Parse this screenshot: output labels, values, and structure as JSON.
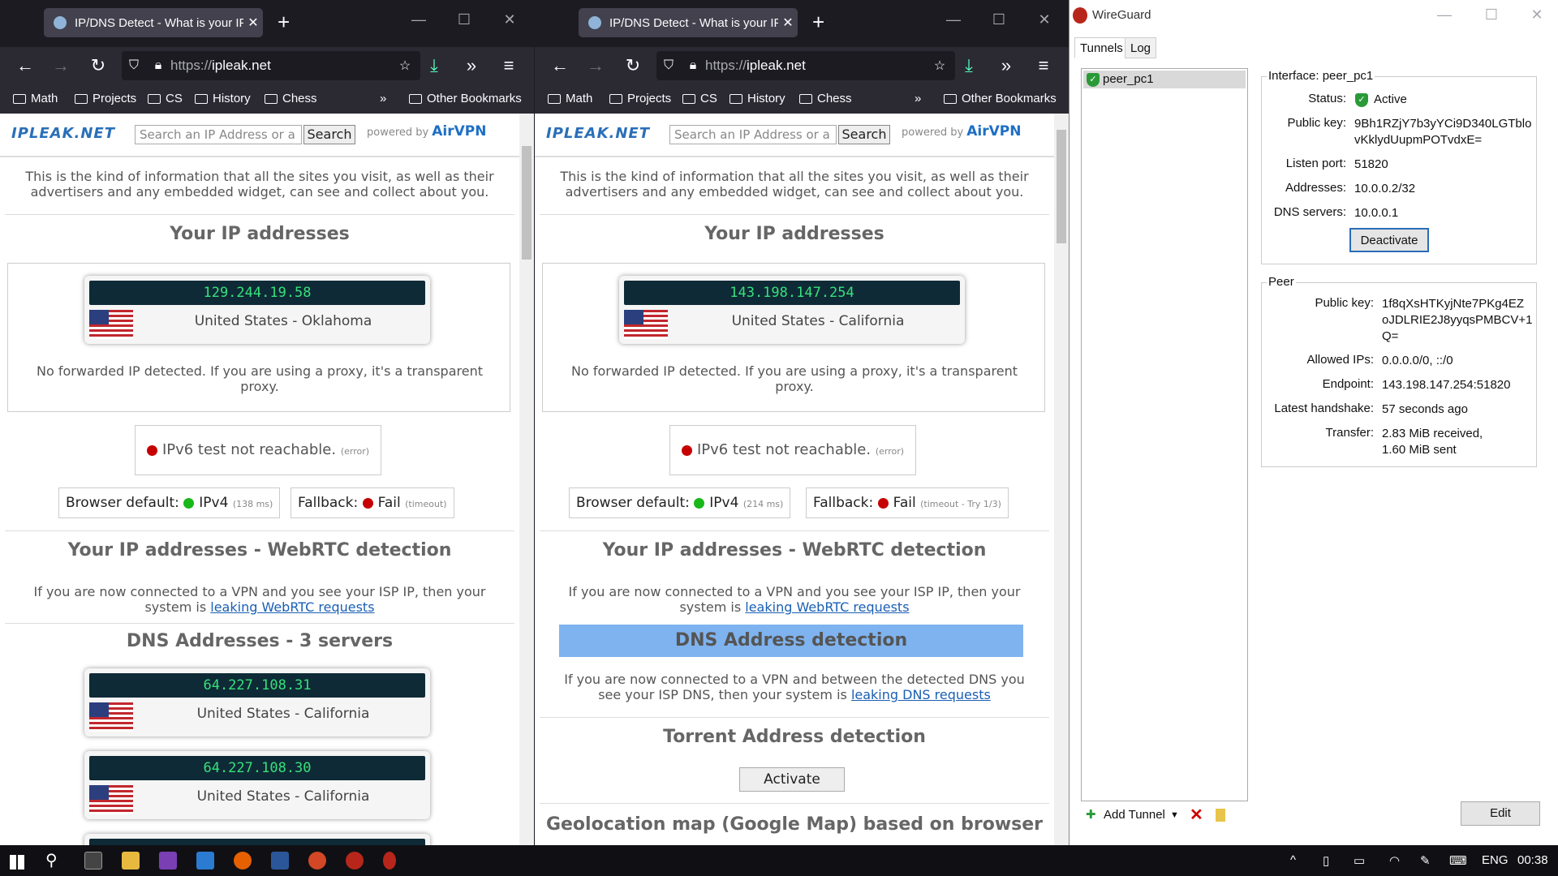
{
  "browser1": {
    "tab_title": "IP/DNS Detect - What is your IP",
    "url_scheme": "https://",
    "url_host": "ipleak.net",
    "bookmarks": [
      "Math",
      "Projects",
      "CS",
      "History",
      "Chess"
    ],
    "other_bookmarks": "Other Bookmarks",
    "site": {
      "logo": "IPLEAK.NET",
      "search_placeholder": "Search an IP Address or a",
      "search_button": "Search",
      "powered_by": "powered by",
      "powered_brand": "AirVPN",
      "intro": "This is the kind of information that all the sites you visit, as well as their advertisers and any embedded widget, can see and collect about you.",
      "ip_heading": "Your IP addresses",
      "ip": "129.244.19.58",
      "ip_location": "United States - Oklahoma",
      "forwarded": "No forwarded IP detected. If you are using a proxy, it's a transparent proxy.",
      "ipv6_text": "IPv6 test not reachable.",
      "ipv6_note": "(error)",
      "browser_default_label": "Browser default:",
      "browser_default_value": "IPv4",
      "browser_default_ms": "(138 ms)",
      "fallback_label": "Fallback:",
      "fallback_value": "Fail",
      "fallback_note": "(timeout)",
      "webrtc_heading": "Your IP addresses - WebRTC detection",
      "webrtc_text": "If you are now connected to a VPN and you see your ISP IP, then your system is",
      "webrtc_link": "leaking WebRTC requests",
      "dns_heading": "DNS Addresses - 3 servers",
      "dns": [
        {
          "ip": "64.227.108.31",
          "location": "United States - California"
        },
        {
          "ip": "64.227.108.30",
          "location": "United States - California"
        }
      ]
    }
  },
  "browser2": {
    "tab_title": "IP/DNS Detect - What is your IP",
    "url_scheme": "https://",
    "url_host": "ipleak.net",
    "bookmarks": [
      "Math",
      "Projects",
      "CS",
      "History",
      "Chess"
    ],
    "other_bookmarks": "Other Bookmarks",
    "site": {
      "logo": "IPLEAK.NET",
      "search_placeholder": "Search an IP Address or a",
      "search_button": "Search",
      "powered_by": "powered by",
      "powered_brand": "AirVPN",
      "intro": "This is the kind of information that all the sites you visit, as well as their advertisers and any embedded widget, can see and collect about you.",
      "ip_heading": "Your IP addresses",
      "ip": "143.198.147.254",
      "ip_location": "United States - California",
      "forwarded": "No forwarded IP detected. If you are using a proxy, it's a transparent proxy.",
      "ipv6_text": "IPv6 test not reachable.",
      "ipv6_note": "(error)",
      "browser_default_label": "Browser default:",
      "browser_default_value": "IPv4",
      "browser_default_ms": "(214 ms)",
      "fallback_label": "Fallback:",
      "fallback_value": "Fail",
      "fallback_note": "(timeout - Try 1/3)",
      "webrtc_heading": "Your IP addresses - WebRTC detection",
      "webrtc_text": "If you are now connected to a VPN and you see your ISP IP, then your system is",
      "webrtc_link": "leaking WebRTC requests",
      "dns_heading": "DNS Address detection",
      "dns_text": "If you are now connected to a VPN and between the detected DNS you see your ISP DNS, then your system is",
      "dns_link": "leaking DNS requests",
      "torrent_heading": "Torrent Address detection",
      "activate_button": "Activate",
      "geo_heading": "Geolocation map (Google Map) based on browser"
    }
  },
  "wireguard": {
    "title": "WireGuard",
    "tabs": [
      "Tunnels",
      "Log"
    ],
    "tunnel_name": "peer_pc1",
    "interface": {
      "legend": "Interface: peer_pc1",
      "status_label": "Status:",
      "status": "Active",
      "pubkey_label": "Public key:",
      "pubkey_1": "9Bh1RZjY7b3yYCi9D340LGTblo",
      "pubkey_2": "vKklydUupmPOTvdxE=",
      "port_label": "Listen port:",
      "port": "51820",
      "addr_label": "Addresses:",
      "addr": "10.0.0.2/32",
      "dns_label": "DNS servers:",
      "dns": "10.0.0.1",
      "deactivate": "Deactivate"
    },
    "peer": {
      "legend": "Peer",
      "pubkey_label": "Public key:",
      "pubkey_1": "1f8qXsHTKyjNte7PKg4EZ",
      "pubkey_2": "oJDLRIE2J8yyqsPMBCV+1",
      "pubkey_3": "Q=",
      "allowed_label": "Allowed IPs:",
      "allowed": "0.0.0.0/0, ::/0",
      "endpoint_label": "Endpoint:",
      "endpoint": "143.198.147.254:51820",
      "handshake_label": "Latest handshake:",
      "handshake": "57 seconds ago",
      "transfer_label": "Transfer:",
      "transfer_1": "2.83 MiB received,",
      "transfer_2": "1.60 MiB sent"
    },
    "add_tunnel": "Add Tunnel",
    "edit": "Edit"
  },
  "taskbar": {
    "lang": "ENG",
    "time": "00:38"
  }
}
